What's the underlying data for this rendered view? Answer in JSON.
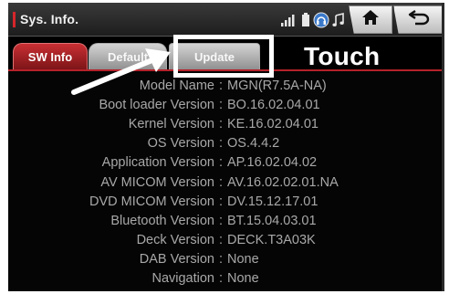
{
  "header": {
    "title": "Sys. Info.",
    "status_icons": [
      "signal-bars-icon",
      "battery-icon",
      "bluetooth-headset-icon",
      "music-note-icon"
    ],
    "home_icon": "home-icon",
    "back_icon": "back-arrow-icon"
  },
  "tabs": [
    {
      "label": "SW Info",
      "active": true
    },
    {
      "label": "Default",
      "active": false
    },
    {
      "label": "Update",
      "active": false
    }
  ],
  "annotation": {
    "touch_label": "Touch"
  },
  "info_rows": [
    {
      "label": "Model Name",
      "value": "MGN(R7.5A-NA)"
    },
    {
      "label": "Boot loader Version",
      "value": "BO.16.02.04.01"
    },
    {
      "label": "Kernel Version",
      "value": "KE.16.02.04.01"
    },
    {
      "label": "OS Version",
      "value": "OS.4.4.2"
    },
    {
      "label": "Application Version",
      "value": "AP.16.02.04.02"
    },
    {
      "label": "AV MICOM Version",
      "value": "AV.16.02.02.01.NA"
    },
    {
      "label": "DVD MICOM Version",
      "value": "DV.15.12.17.01"
    },
    {
      "label": "Bluetooth Version",
      "value": "BT.15.04.03.01"
    },
    {
      "label": "Deck Version",
      "value": "DECK.T3A03K"
    },
    {
      "label": "DAB Version",
      "value": "None"
    },
    {
      "label": "Navigation",
      "value": "None"
    }
  ],
  "colors": {
    "accent_red": "#c92f33",
    "background": "#050505",
    "text_gray": "#a8a8a8"
  }
}
